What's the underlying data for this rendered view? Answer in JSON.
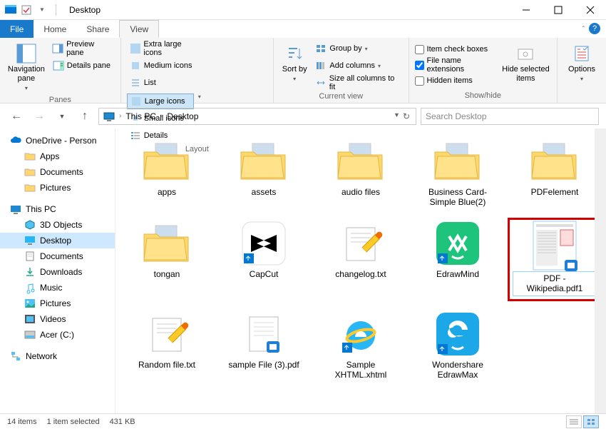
{
  "titlebar": {
    "title": "Desktop"
  },
  "tabs": {
    "file": "File",
    "home": "Home",
    "share": "Share",
    "view": "View"
  },
  "ribbon": {
    "panes": {
      "nav": "Navigation pane",
      "preview": "Preview pane",
      "details": "Details pane",
      "group_label": "Panes"
    },
    "layout": {
      "extra_large": "Extra large icons",
      "large": "Large icons",
      "medium": "Medium icons",
      "small": "Small icons",
      "list": "List",
      "details": "Details",
      "group_label": "Layout"
    },
    "currentview": {
      "sortby": "Sort by",
      "groupby": "Group by",
      "addcolumns": "Add columns",
      "sizeall": "Size all columns to fit",
      "group_label": "Current view"
    },
    "showhide": {
      "item_checkboxes": "Item check boxes",
      "file_ext": "File name extensions",
      "hidden_items": "Hidden items",
      "hide_selected": "Hide selected items",
      "group_label": "Show/hide"
    },
    "options": "Options"
  },
  "breadcrumb": {
    "root": "This PC",
    "current": "Desktop"
  },
  "search": {
    "placeholder": "Search Desktop"
  },
  "sidebar": {
    "onedrive": "OneDrive - Person",
    "apps": "Apps",
    "documents": "Documents",
    "pictures": "Pictures",
    "thispc": "This PC",
    "objects3d": "3D Objects",
    "desktop": "Desktop",
    "documents2": "Documents",
    "downloads": "Downloads",
    "music": "Music",
    "pictures2": "Pictures",
    "videos": "Videos",
    "acer": "Acer (C:)",
    "network": "Network"
  },
  "files": [
    {
      "label": "apps",
      "kind": "folder"
    },
    {
      "label": "assets",
      "kind": "folder"
    },
    {
      "label": "audio files",
      "kind": "folder"
    },
    {
      "label": "Business Card-Simple Blue(2)",
      "kind": "folder"
    },
    {
      "label": "PDFelement",
      "kind": "folder"
    },
    {
      "label": "tongan",
      "kind": "folder"
    },
    {
      "label": "CapCut",
      "kind": "app-capcut"
    },
    {
      "label": "changelog.txt",
      "kind": "txt"
    },
    {
      "label": "EdrawMind",
      "kind": "app-edrawmind"
    },
    {
      "label": "PDF - Wikipedia.pdf1",
      "kind": "pdf-selected"
    },
    {
      "label": "Random file.txt",
      "kind": "txt"
    },
    {
      "label": "sample File (3).pdf",
      "kind": "pdf"
    },
    {
      "label": "Sample XHTML.xhtml",
      "kind": "xhtml"
    },
    {
      "label": "Wondershare EdrawMax",
      "kind": "app-edrawmax"
    }
  ],
  "statusbar": {
    "items": "14 items",
    "selected": "1 item selected",
    "size": "431 KB"
  }
}
